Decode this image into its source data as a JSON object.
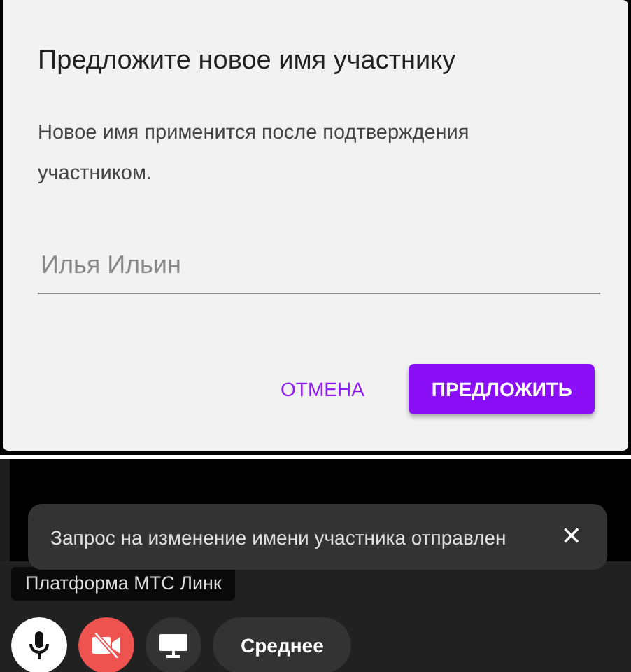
{
  "dialog": {
    "title": "Предложите новое имя участнику",
    "message": "Новое имя применится после подтверждения участником.",
    "input": {
      "placeholder": "Илья Ильин"
    },
    "buttons": [
      {
        "label": "ОТМЕНА",
        "kind": "text"
      },
      {
        "label": "ПРЕДЛОЖИТЬ",
        "kind": "primary"
      }
    ]
  },
  "toast": {
    "message": "Запрос на изменение имени участника отправлен",
    "close": "✕"
  },
  "participant_label": "Платформа МТС Линк",
  "controls": [
    {
      "kind": "mic",
      "on": true
    },
    {
      "kind": "camera",
      "on": false
    },
    {
      "kind": "screen",
      "on": false
    },
    {
      "kind": "quality",
      "label": "Среднее"
    }
  ]
}
